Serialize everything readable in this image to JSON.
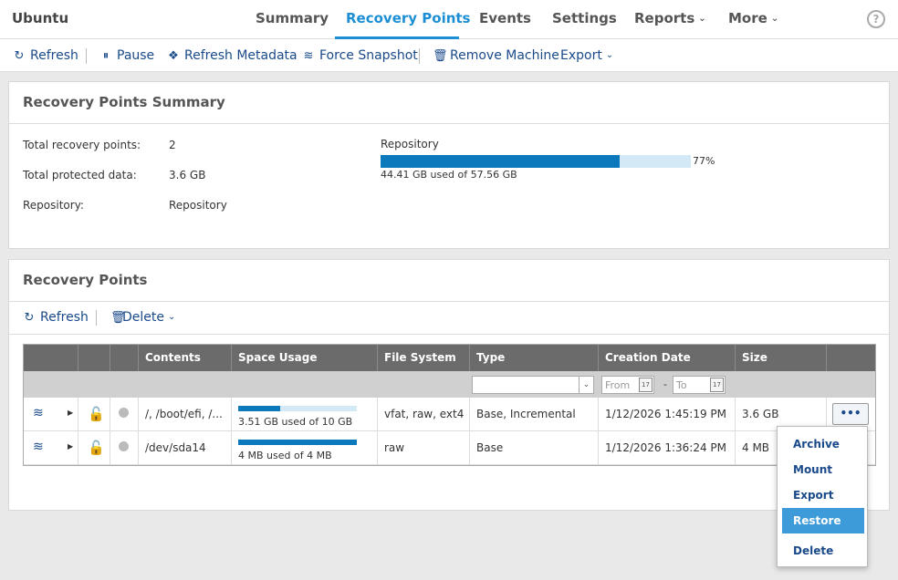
{
  "header": {
    "machine_name": "Ubuntu",
    "tabs": [
      {
        "label": "Summary"
      },
      {
        "label": "Recovery Points"
      },
      {
        "label": "Events"
      },
      {
        "label": "Settings"
      },
      {
        "label": "Reports"
      },
      {
        "label": "More"
      }
    ],
    "help_label": "?"
  },
  "toolbar": {
    "refresh": "Refresh",
    "pause": "Pause",
    "refresh_metadata": "Refresh Metadata",
    "force_snapshot": "Force Snapshot",
    "remove_machine": "Remove Machine",
    "export": "Export"
  },
  "summary": {
    "title": "Recovery Points Summary",
    "rows": [
      {
        "label": "Total recovery points:",
        "value": "2"
      },
      {
        "label": "Total protected data:",
        "value": "3.6 GB"
      },
      {
        "label": "Repository:",
        "value": "Repository"
      }
    ],
    "repository": {
      "title": "Repository",
      "percent_label": "77%",
      "fraction": 0.77,
      "used_text": "44.41 GB used of 57.56 GB"
    }
  },
  "recovery_points": {
    "title": "Recovery Points",
    "refresh": "Refresh",
    "delete": "Delete",
    "columns": [
      "Contents",
      "Space Usage",
      "File System",
      "Type",
      "Creation Date",
      "Size"
    ],
    "filter": {
      "from_placeholder": "From",
      "to_placeholder": "To",
      "calendar_label": "17",
      "dash": "-"
    },
    "rows": [
      {
        "contents": "/, /boot/efi, /...",
        "usage_fraction": 0.351,
        "usage_text": "3.51 GB used of 10 GB",
        "file_system": "vfat, raw, ext4",
        "type": "Base, Incremental",
        "creation_date": "1/12/2026 1:45:19 PM",
        "size": "3.6 GB"
      },
      {
        "contents": "/dev/sda14",
        "usage_fraction": 1.0,
        "usage_text": "4 MB used of 4 MB",
        "file_system": "raw",
        "type": "Base",
        "creation_date": "1/12/2026 1:36:24 PM",
        "size": "4 MB"
      }
    ],
    "more_button": "•••"
  },
  "context_menu": {
    "items": [
      "Archive",
      "Mount",
      "Export",
      "Restore",
      "Delete"
    ],
    "highlighted": "Restore"
  }
}
